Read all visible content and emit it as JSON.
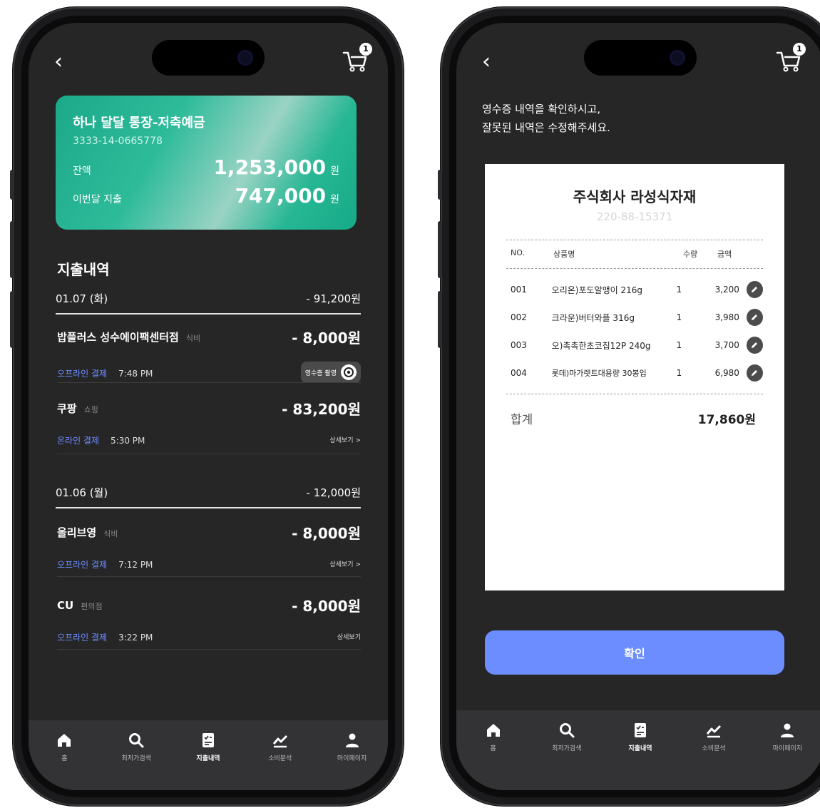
{
  "phone1": {
    "cart_count": "1",
    "account": {
      "name": "하나 달달 통장-저축예금",
      "number": "3333-14-0665778",
      "balance_label": "잔액",
      "balance": "1,253,000",
      "spend_label": "이번달 지출",
      "spend": "747,000",
      "unit": "원"
    },
    "section_title": "지출내역",
    "days": [
      {
        "date": "01.07 (화)",
        "total": "- 91,200원",
        "items": [
          {
            "merchant": "밥플러스 성수에이팩센터점",
            "category": "식비",
            "amount": "- 8,000원",
            "payment": "오프라인 결제",
            "time": "7:48 PM",
            "action": "영수증 촬영"
          },
          {
            "merchant": "쿠팡",
            "category": "쇼핑",
            "amount": "- 83,200원",
            "payment": "온라인 결제",
            "time": "5:30 PM",
            "action": "상세보기 >"
          }
        ]
      },
      {
        "date": "01.06 (월)",
        "total": "- 12,000원",
        "items": [
          {
            "merchant": "올리브영",
            "category": "식비",
            "amount": "- 8,000원",
            "payment": "오프라인 결제",
            "time": "7:12 PM",
            "action": "상세보기 >"
          },
          {
            "merchant": "CU",
            "category": "편의점",
            "amount": "- 8,000원",
            "payment": "오프라인 결제",
            "time": "3:22 PM",
            "action": "상세보기"
          }
        ]
      }
    ]
  },
  "phone2": {
    "cart_count": "1",
    "guide_line1": "영수증 내역을 확인하시고,",
    "guide_line2": "잘못된 내역은 수정해주세요.",
    "receipt": {
      "company": "주식회사 라성식자재",
      "biz_no": "220-88-15371",
      "headers": {
        "no": "NO.",
        "name": "상품명",
        "qty": "수량",
        "amount": "금액"
      },
      "rows": [
        {
          "no": "001",
          "name": "오리온)포도알맹이 216g",
          "qty": "1",
          "amount": "3,200"
        },
        {
          "no": "002",
          "name": "크라운)버터와플 316g",
          "qty": "1",
          "amount": "3,980"
        },
        {
          "no": "003",
          "name": "오)촉촉한초코칩12P 240g",
          "qty": "1",
          "amount": "3,700"
        },
        {
          "no": "004",
          "name": "롯데)마가렛트대용량 30봉입",
          "qty": "1",
          "amount": "6,980"
        }
      ],
      "total_label": "합계",
      "total_value": "17,860원"
    },
    "confirm_label": "확인"
  },
  "tabs": [
    {
      "label": "홈",
      "icon": "home-icon"
    },
    {
      "label": "최저가검색",
      "icon": "search-icon"
    },
    {
      "label": "지출내역",
      "icon": "expense-icon"
    },
    {
      "label": "소비분석",
      "icon": "chart-icon"
    },
    {
      "label": "마이페이지",
      "icon": "person-icon"
    }
  ],
  "active_tab": "지출내역",
  "colors": {
    "accent": "#6b8dff",
    "card_green": "#1ba98a",
    "screen_bg": "#262626"
  }
}
